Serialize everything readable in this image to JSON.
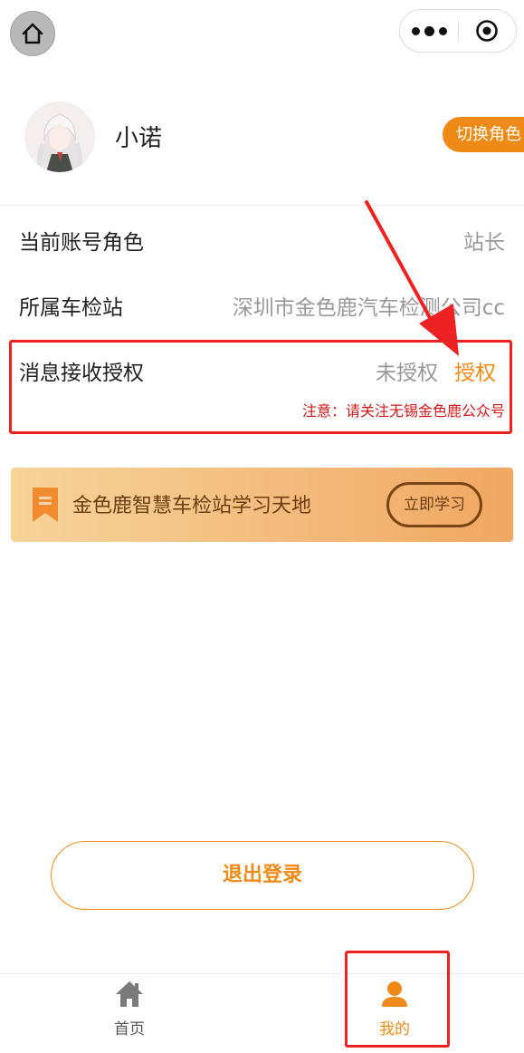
{
  "nav": {
    "home_icon": "home-icon",
    "more_icon": "more-dots-icon",
    "close_icon": "target-circle-icon"
  },
  "profile": {
    "name": "小诺",
    "switch_role_label": "切换角色"
  },
  "info": {
    "role_label": "当前账号角色",
    "role_value": "站长",
    "station_label": "所属车检站",
    "station_value": "深圳市金色鹿汽车检测公司cc",
    "auth_label": "消息接收授权",
    "auth_status": "未授权",
    "auth_action": "授权",
    "auth_note": "注意：请关注无锡金色鹿公众号"
  },
  "banner": {
    "title": "金色鹿智慧车检站学习天地",
    "button_label": "立即学习",
    "icon": "bookmark-icon"
  },
  "logout_label": "退出登录",
  "tabbar": {
    "tabs": [
      {
        "label": "首页",
        "icon": "home-icon",
        "active": false
      },
      {
        "label": "我的",
        "icon": "user-icon",
        "active": true
      }
    ]
  },
  "colors": {
    "accent": "#f08a16",
    "annotation": "#ee2222",
    "note": "#d11717"
  }
}
